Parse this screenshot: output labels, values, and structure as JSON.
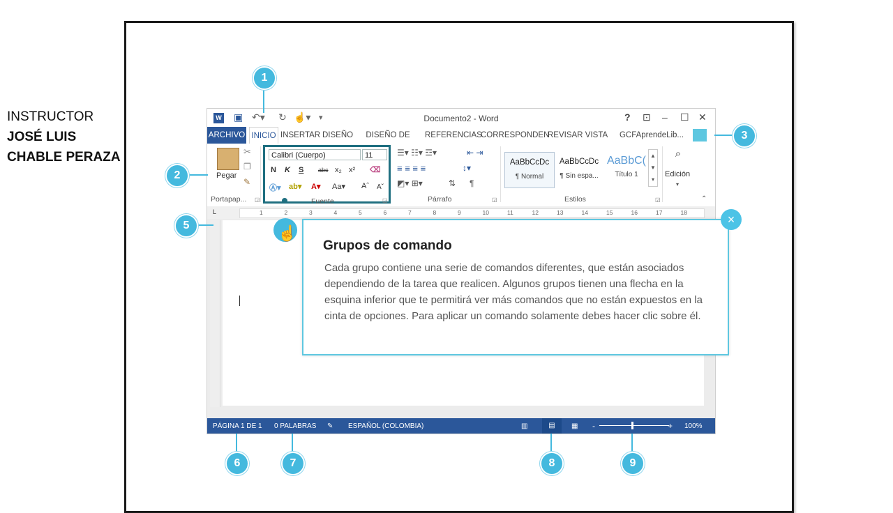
{
  "instructor": {
    "line1": "INSTRUCTOR",
    "line2": "JOSÉ LUIS",
    "line3": "CHABLE PERAZA"
  },
  "window": {
    "title": "Documento2 - Word",
    "help": "?"
  },
  "tabs": [
    {
      "label": "ARCHIVO"
    },
    {
      "label": "INICIO"
    },
    {
      "label": "INSERTAR"
    },
    {
      "label": "DISEÑO"
    },
    {
      "label": "DISEÑO DE PÁGI"
    },
    {
      "label": "REFERENCIAS"
    },
    {
      "label": "CORRESPONDEN"
    },
    {
      "label": "REVISAR"
    },
    {
      "label": "VISTA"
    },
    {
      "label": "GCFAprendeLib..."
    }
  ],
  "ribbon": {
    "paste_label": "Pegar",
    "groups": {
      "clipboard": "Portapap...",
      "font": "Fuente",
      "paragraph": "Párrafo",
      "styles": "Estilos"
    },
    "font_family": "Calibri (Cuerpo)",
    "font_size": "11",
    "font_buttons": {
      "bold": "N",
      "italic": "K",
      "underline": "S",
      "strike": "abc",
      "sub": "x₂",
      "sup": "x²"
    },
    "styles": [
      {
        "preview": "AaBbCcDc",
        "name": "¶ Normal"
      },
      {
        "preview": "AaBbCcDc",
        "name": "¶ Sin espa..."
      },
      {
        "preview": "AaBbC(",
        "name": "Título 1"
      }
    ],
    "edit_label": "Edición"
  },
  "ruler_ticks": [
    "1",
    "2",
    "3",
    "4",
    "5",
    "6",
    "7",
    "8",
    "9",
    "10",
    "11",
    "12",
    "13",
    "14",
    "15",
    "16",
    "17",
    "18"
  ],
  "status": {
    "page": "PÁGINA 1 DE 1",
    "words": "0 PALABRAS",
    "language": "ESPAÑOL (COLOMBIA)",
    "zoom": "100%",
    "zoom_minus": "-",
    "zoom_plus": "+"
  },
  "callout": {
    "title": "Grupos de comando",
    "body": "Cada grupo contiene una serie de comandos diferentes, que están asociados dependiendo de la tarea que realicen. Algunos grupos tienen una flecha en la esquina inferior que te permitirá ver más comandos que no están expuestos en la cinta de opciones. Para aplicar un comando solamente debes hacer clic sobre él.",
    "close": "×"
  },
  "badges": [
    "1",
    "2",
    "3",
    "5",
    "6",
    "7",
    "8",
    "9"
  ],
  "colors": {
    "word_blue": "#2b579a",
    "accent_cyan": "#44b9de",
    "highlight_teal": "#1f6f80"
  }
}
